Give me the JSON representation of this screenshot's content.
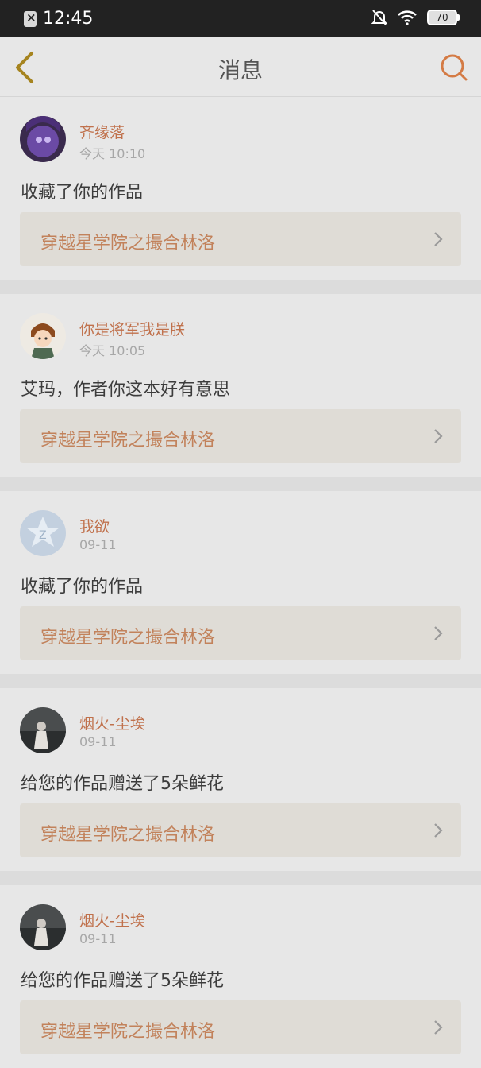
{
  "status_bar": {
    "time": "12:45",
    "battery": "70",
    "icons": [
      "notification-app-icon",
      "silent-bell-icon",
      "wifi-icon",
      "battery-icon"
    ]
  },
  "header": {
    "title": "消息",
    "back_icon": "chevron-left-icon",
    "search_icon": "search-icon"
  },
  "colors": {
    "accent": "#c0714c",
    "work_title": "#c2825b",
    "background": "#e7e7e7"
  },
  "messages": [
    {
      "user": "齐缘落",
      "time": "今天 10:10",
      "text": "收藏了你的作品",
      "work": "穿越星学院之撮合林洛"
    },
    {
      "user": "你是将军我是朕",
      "time": "今天 10:05",
      "text": "艾玛，作者你这本好有意思",
      "work": "穿越星学院之撮合林洛"
    },
    {
      "user": "我欲",
      "time": "09-11",
      "text": "收藏了你的作品",
      "work": "穿越星学院之撮合林洛"
    },
    {
      "user": "烟火-尘埃",
      "time": "09-11",
      "text": "给您的作品赠送了5朵鲜花",
      "work": "穿越星学院之撮合林洛"
    },
    {
      "user": "烟火-尘埃",
      "time": "09-11",
      "text": "给您的作品赠送了5朵鲜花",
      "work": "穿越星学院之撮合林洛"
    }
  ]
}
